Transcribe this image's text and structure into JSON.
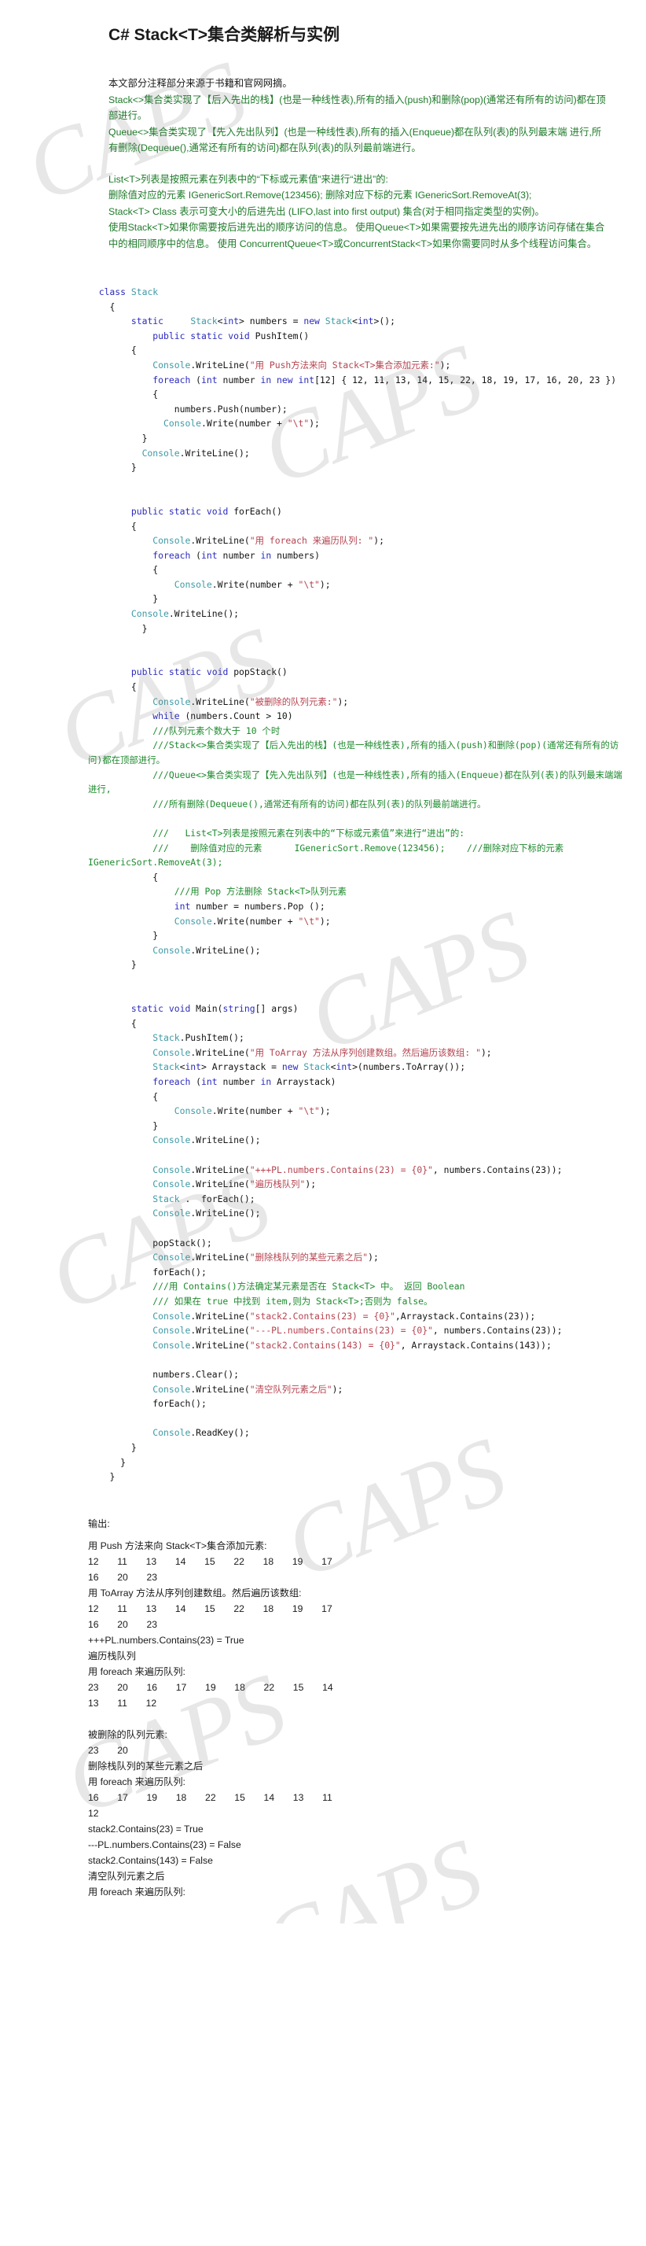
{
  "document": {
    "title": "C# Stack<T>集合类解析与实例",
    "watermark_text": "CAPS"
  },
  "intro": {
    "line1": "本文部分注释部分来源于书籍和官网网摘。",
    "line2": "Stack<>集合类实现了【后入先出的栈】(也是一种线性表),所有的插入(push)和删除(pop)(通常还有所有的访问)都在顶部进行。",
    "line3": "Queue<>集合类实现了【先入先出队列】(也是一种线性表),所有的插入(Enqueue)都在队列(表)的队列最末端 进行,所有删除(Dequeue(),通常还有所有的访问)都在队列(表)的队列最前端进行。",
    "line4": "List<T>列表是按照元素在列表中的“下标或元素值”来进行“进出”的:",
    "line5": "删除值对应的元素      IGenericSort.Remove(123456);     删除对应下标的元素 IGenericSort.RemoveAt(3);",
    "line6": "Stack<T> Class 表示可变大小的后进先出 (LIFO,last into first output) 集合(对于相同指定类型的实例)。",
    "line7": " 使用Stack<T>如果你需要按后进先出的顺序访问的信息。 使用Queue<T>如果需要按先进先出的顺序访问存储在集合中的相同顺序中的信息。 使用 ConcurrentQueue<T>或ConcurrentStack<T>如果你需要同时从多个线程访问集合。"
  },
  "code": {
    "lines": [
      [
        {
          "t": "  class ",
          "c": "kw"
        },
        {
          "t": "Stack",
          "c": "cls"
        }
      ],
      [
        {
          "t": "    {",
          "c": "plain"
        }
      ],
      [
        {
          "t": "        static     ",
          "c": "kw"
        },
        {
          "t": "Stack",
          "c": "cls"
        },
        {
          "t": "<",
          "c": "plain"
        },
        {
          "t": "int",
          "c": "kw"
        },
        {
          "t": "> numbers = ",
          "c": "plain"
        },
        {
          "t": "new ",
          "c": "kw"
        },
        {
          "t": "Stack",
          "c": "cls"
        },
        {
          "t": "<",
          "c": "plain"
        },
        {
          "t": "int",
          "c": "kw"
        },
        {
          "t": ">();",
          "c": "plain"
        }
      ],
      [
        {
          "t": "            public static void ",
          "c": "kw"
        },
        {
          "t": "PushItem()",
          "c": "plain"
        }
      ],
      [
        {
          "t": "        {",
          "c": "plain"
        }
      ],
      [
        {
          "t": "            ",
          "c": "plain"
        },
        {
          "t": "Console",
          "c": "type"
        },
        {
          "t": ".WriteLine(",
          "c": "plain"
        },
        {
          "t": "\"用 Push方法来向 Stack<T>集合添加元素:\"",
          "c": "str"
        },
        {
          "t": ");",
          "c": "plain"
        }
      ],
      [
        {
          "t": "            ",
          "c": "plain"
        },
        {
          "t": "foreach ",
          "c": "kw"
        },
        {
          "t": "(",
          "c": "plain"
        },
        {
          "t": "int ",
          "c": "kw"
        },
        {
          "t": "number ",
          "c": "plain"
        },
        {
          "t": "in new int",
          "c": "kw"
        },
        {
          "t": "[12] { 12, 11, 13, 14, 15, 22, 18, 19, 17, 16, 20, 23 })",
          "c": "plain"
        }
      ],
      [
        {
          "t": "            {",
          "c": "plain"
        }
      ],
      [
        {
          "t": "                numbers.Push(number);",
          "c": "plain"
        }
      ],
      [
        {
          "t": "              ",
          "c": "plain"
        },
        {
          "t": "Console",
          "c": "type"
        },
        {
          "t": ".Write(number + ",
          "c": "plain"
        },
        {
          "t": "\"\\t\"",
          "c": "str"
        },
        {
          "t": ");",
          "c": "plain"
        }
      ],
      [
        {
          "t": "          }",
          "c": "plain"
        }
      ],
      [
        {
          "t": "          ",
          "c": "plain"
        },
        {
          "t": "Console",
          "c": "type"
        },
        {
          "t": ".WriteLine();",
          "c": "plain"
        }
      ],
      [
        {
          "t": "        }",
          "c": "plain"
        }
      ],
      [
        {
          "t": "",
          "c": "plain"
        }
      ],
      [
        {
          "t": "",
          "c": "plain"
        }
      ],
      [
        {
          "t": "        public static void ",
          "c": "kw"
        },
        {
          "t": "forEach()",
          "c": "plain"
        }
      ],
      [
        {
          "t": "        {",
          "c": "plain"
        }
      ],
      [
        {
          "t": "            ",
          "c": "plain"
        },
        {
          "t": "Console",
          "c": "type"
        },
        {
          "t": ".WriteLine(",
          "c": "plain"
        },
        {
          "t": "\"用 foreach 来遍历队列: \"",
          "c": "str"
        },
        {
          "t": ");",
          "c": "plain"
        }
      ],
      [
        {
          "t": "            ",
          "c": "plain"
        },
        {
          "t": "foreach ",
          "c": "kw"
        },
        {
          "t": "(",
          "c": "plain"
        },
        {
          "t": "int ",
          "c": "kw"
        },
        {
          "t": "number ",
          "c": "plain"
        },
        {
          "t": "in ",
          "c": "kw"
        },
        {
          "t": "numbers)",
          "c": "plain"
        }
      ],
      [
        {
          "t": "            {",
          "c": "plain"
        }
      ],
      [
        {
          "t": "                ",
          "c": "plain"
        },
        {
          "t": "Console",
          "c": "type"
        },
        {
          "t": ".Write(number + ",
          "c": "plain"
        },
        {
          "t": "\"\\t\"",
          "c": "str"
        },
        {
          "t": ");",
          "c": "plain"
        }
      ],
      [
        {
          "t": "            }",
          "c": "plain"
        }
      ],
      [
        {
          "t": "        ",
          "c": "plain"
        },
        {
          "t": "Console",
          "c": "type"
        },
        {
          "t": ".WriteLine();",
          "c": "plain"
        }
      ],
      [
        {
          "t": "          }",
          "c": "plain"
        }
      ],
      [
        {
          "t": "",
          "c": "plain"
        }
      ],
      [
        {
          "t": "",
          "c": "plain"
        }
      ],
      [
        {
          "t": "        public static void ",
          "c": "kw"
        },
        {
          "t": "popStack()",
          "c": "plain"
        }
      ],
      [
        {
          "t": "        {",
          "c": "plain"
        }
      ],
      [
        {
          "t": "            ",
          "c": "plain"
        },
        {
          "t": "Console",
          "c": "type"
        },
        {
          "t": ".WriteLine(",
          "c": "plain"
        },
        {
          "t": "\"被删除的队列元素:\"",
          "c": "str"
        },
        {
          "t": ");",
          "c": "plain"
        }
      ],
      [
        {
          "t": "            ",
          "c": "plain"
        },
        {
          "t": "while ",
          "c": "kw"
        },
        {
          "t": "(numbers.Count > 10)",
          "c": "plain"
        }
      ],
      [
        {
          "t": "            ///队列元素个数大于 10 个时",
          "c": "cmt"
        }
      ],
      [
        {
          "t": "            ///Stack<>集合类实现了【后入先出的栈】(也是一种线性表),所有的插入(push)和删除(pop)(通常还有所有的访问)都在顶部进行。",
          "c": "cmt"
        }
      ],
      [
        {
          "t": "            ///Queue<>集合类实现了【先入先出队列】(也是一种线性表),所有的插入(Enqueue)都在队列(表)的队列最末端端进行,",
          "c": "cmt"
        }
      ],
      [
        {
          "t": "            ///所有删除(Dequeue(),通常还有所有的访问)都在队列(表)的队列最前端进行。",
          "c": "cmt"
        }
      ],
      [
        {
          "t": "",
          "c": "plain"
        }
      ],
      [
        {
          "t": "            ///   List<T>列表是按照元素在列表中的“下标或元素值”来进行“进出”的:",
          "c": "cmt"
        }
      ],
      [
        {
          "t": "            ///    删除值对应的元素      IGenericSort.Remove(123456);    ///删除对应下标的元素   IGenericSort.RemoveAt(3);",
          "c": "cmt"
        }
      ],
      [
        {
          "t": "            {",
          "c": "plain"
        }
      ],
      [
        {
          "t": "                ///用 Pop 方法删除 Stack<T>队列元素",
          "c": "cmt"
        }
      ],
      [
        {
          "t": "                ",
          "c": "plain"
        },
        {
          "t": "int ",
          "c": "kw"
        },
        {
          "t": "number = numbers.Pop ();",
          "c": "plain"
        }
      ],
      [
        {
          "t": "                ",
          "c": "plain"
        },
        {
          "t": "Console",
          "c": "type"
        },
        {
          "t": ".Write(number + ",
          "c": "plain"
        },
        {
          "t": "\"\\t\"",
          "c": "str"
        },
        {
          "t": ");",
          "c": "plain"
        }
      ],
      [
        {
          "t": "            }",
          "c": "plain"
        }
      ],
      [
        {
          "t": "            ",
          "c": "plain"
        },
        {
          "t": "Console",
          "c": "type"
        },
        {
          "t": ".WriteLine();",
          "c": "plain"
        }
      ],
      [
        {
          "t": "        }",
          "c": "plain"
        }
      ],
      [
        {
          "t": "",
          "c": "plain"
        }
      ],
      [
        {
          "t": "",
          "c": "plain"
        }
      ],
      [
        {
          "t": "        static void ",
          "c": "kw"
        },
        {
          "t": "Main(",
          "c": "plain"
        },
        {
          "t": "string",
          "c": "kw"
        },
        {
          "t": "[] args)",
          "c": "plain"
        }
      ],
      [
        {
          "t": "        {",
          "c": "plain"
        }
      ],
      [
        {
          "t": "            ",
          "c": "plain"
        },
        {
          "t": "Stack",
          "c": "type"
        },
        {
          "t": ".PushItem();",
          "c": "plain"
        }
      ],
      [
        {
          "t": "            ",
          "c": "plain"
        },
        {
          "t": "Console",
          "c": "type"
        },
        {
          "t": ".WriteLine(",
          "c": "plain"
        },
        {
          "t": "\"用 ToArray 方法从序列创建数组。然后遍历该数组: \"",
          "c": "str"
        },
        {
          "t": ");",
          "c": "plain"
        }
      ],
      [
        {
          "t": "            ",
          "c": "plain"
        },
        {
          "t": "Stack",
          "c": "type"
        },
        {
          "t": "<",
          "c": "plain"
        },
        {
          "t": "int",
          "c": "kw"
        },
        {
          "t": "> Arraystack = ",
          "c": "plain"
        },
        {
          "t": "new ",
          "c": "kw"
        },
        {
          "t": "Stack",
          "c": "type"
        },
        {
          "t": "<",
          "c": "plain"
        },
        {
          "t": "int",
          "c": "kw"
        },
        {
          "t": ">(numbers.ToArray());",
          "c": "plain"
        }
      ],
      [
        {
          "t": "            ",
          "c": "plain"
        },
        {
          "t": "foreach ",
          "c": "kw"
        },
        {
          "t": "(",
          "c": "plain"
        },
        {
          "t": "int ",
          "c": "kw"
        },
        {
          "t": "number ",
          "c": "plain"
        },
        {
          "t": "in ",
          "c": "kw"
        },
        {
          "t": "Arraystack)",
          "c": "plain"
        }
      ],
      [
        {
          "t": "            {",
          "c": "plain"
        }
      ],
      [
        {
          "t": "                ",
          "c": "plain"
        },
        {
          "t": "Console",
          "c": "type"
        },
        {
          "t": ".Write(number + ",
          "c": "plain"
        },
        {
          "t": "\"\\t\"",
          "c": "str"
        },
        {
          "t": ");",
          "c": "plain"
        }
      ],
      [
        {
          "t": "            }",
          "c": "plain"
        }
      ],
      [
        {
          "t": "            ",
          "c": "plain"
        },
        {
          "t": "Console",
          "c": "type"
        },
        {
          "t": ".WriteLine();",
          "c": "plain"
        }
      ],
      [
        {
          "t": "",
          "c": "plain"
        }
      ],
      [
        {
          "t": "            ",
          "c": "plain"
        },
        {
          "t": "Console",
          "c": "type"
        },
        {
          "t": ".WriteLine(",
          "c": "plain"
        },
        {
          "t": "\"+++PL.numbers.Contains(23) = {0}\"",
          "c": "str"
        },
        {
          "t": ", numbers.Contains(23));",
          "c": "plain"
        }
      ],
      [
        {
          "t": "            ",
          "c": "plain"
        },
        {
          "t": "Console",
          "c": "type"
        },
        {
          "t": ".WriteLine(",
          "c": "plain"
        },
        {
          "t": "\"遍历栈队列\"",
          "c": "str"
        },
        {
          "t": ");",
          "c": "plain"
        }
      ],
      [
        {
          "t": "            ",
          "c": "plain"
        },
        {
          "t": "Stack",
          "c": "type"
        },
        {
          "t": " .  forEach();",
          "c": "plain"
        }
      ],
      [
        {
          "t": "            ",
          "c": "plain"
        },
        {
          "t": "Console",
          "c": "type"
        },
        {
          "t": ".WriteLine();",
          "c": "plain"
        }
      ],
      [
        {
          "t": "",
          "c": "plain"
        }
      ],
      [
        {
          "t": "            popStack();",
          "c": "plain"
        }
      ],
      [
        {
          "t": "            ",
          "c": "plain"
        },
        {
          "t": "Console",
          "c": "type"
        },
        {
          "t": ".WriteLine(",
          "c": "plain"
        },
        {
          "t": "\"删除栈队列的某些元素之后\"",
          "c": "str"
        },
        {
          "t": ");",
          "c": "plain"
        }
      ],
      [
        {
          "t": "            forEach();",
          "c": "plain"
        }
      ],
      [
        {
          "t": "            ///用 Contains()方法确定某元素是否在 Stack<T> 中。 返回 Boolean",
          "c": "cmt"
        }
      ],
      [
        {
          "t": "            /// 如果在 true 中找到 item,则为 Stack<T>;否则为 false。",
          "c": "cmt"
        }
      ],
      [
        {
          "t": "            ",
          "c": "plain"
        },
        {
          "t": "Console",
          "c": "type"
        },
        {
          "t": ".WriteLine(",
          "c": "plain"
        },
        {
          "t": "\"stack2.Contains(23) = {0}\"",
          "c": "str"
        },
        {
          "t": ",Arraystack.Contains(23));",
          "c": "plain"
        }
      ],
      [
        {
          "t": "            ",
          "c": "plain"
        },
        {
          "t": "Console",
          "c": "type"
        },
        {
          "t": ".WriteLine(",
          "c": "plain"
        },
        {
          "t": "\"---PL.numbers.Contains(23) = {0}\"",
          "c": "str"
        },
        {
          "t": ", numbers.Contains(23));",
          "c": "plain"
        }
      ],
      [
        {
          "t": "            ",
          "c": "plain"
        },
        {
          "t": "Console",
          "c": "type"
        },
        {
          "t": ".WriteLine(",
          "c": "plain"
        },
        {
          "t": "\"stack2.Contains(143) = {0}\"",
          "c": "str"
        },
        {
          "t": ", Arraystack.Contains(143));",
          "c": "plain"
        }
      ],
      [
        {
          "t": "",
          "c": "plain"
        }
      ],
      [
        {
          "t": "            numbers.Clear();",
          "c": "plain"
        }
      ],
      [
        {
          "t": "            ",
          "c": "plain"
        },
        {
          "t": "Console",
          "c": "type"
        },
        {
          "t": ".WriteLine(",
          "c": "plain"
        },
        {
          "t": "\"清空队列元素之后\"",
          "c": "str"
        },
        {
          "t": ");",
          "c": "plain"
        }
      ],
      [
        {
          "t": "            forEach();",
          "c": "plain"
        }
      ],
      [
        {
          "t": "",
          "c": "plain"
        }
      ],
      [
        {
          "t": "            ",
          "c": "plain"
        },
        {
          "t": "Console",
          "c": "type"
        },
        {
          "t": ".ReadKey();",
          "c": "plain"
        }
      ],
      [
        {
          "t": "        }",
          "c": "plain"
        }
      ],
      [
        {
          "t": "      }",
          "c": "plain"
        }
      ],
      [
        {
          "t": "    }",
          "c": "plain"
        }
      ]
    ]
  },
  "output": {
    "label": "输出:",
    "lines": [
      "用 Push 方法来向 Stack<T>集合添加元素:",
      "12       11       13       14       15       22       18       19       17",
      "16       20       23",
      "用 ToArray 方法从序列创建数组。然后遍历该数组:",
      "12       11       13       14       15       22       18       19       17",
      "16       20       23",
      "+++PL.numbers.Contains(23) = True",
      "遍历栈队列",
      "用 foreach 来遍历队列:",
      "23       20       16       17       19       18       22       15       14",
      "13       11       12",
      "",
      "被删除的队列元素:",
      "23       20",
      "删除栈队列的某些元素之后",
      "用 foreach 来遍历队列:",
      "16       17       19       18       22       15       14       13       11",
      "12",
      "stack2.Contains(23) = True",
      "---PL.numbers.Contains(23) = False",
      "stack2.Contains(143) = False",
      "清空队列元素之后",
      "用 foreach 来遍历队列:"
    ]
  }
}
